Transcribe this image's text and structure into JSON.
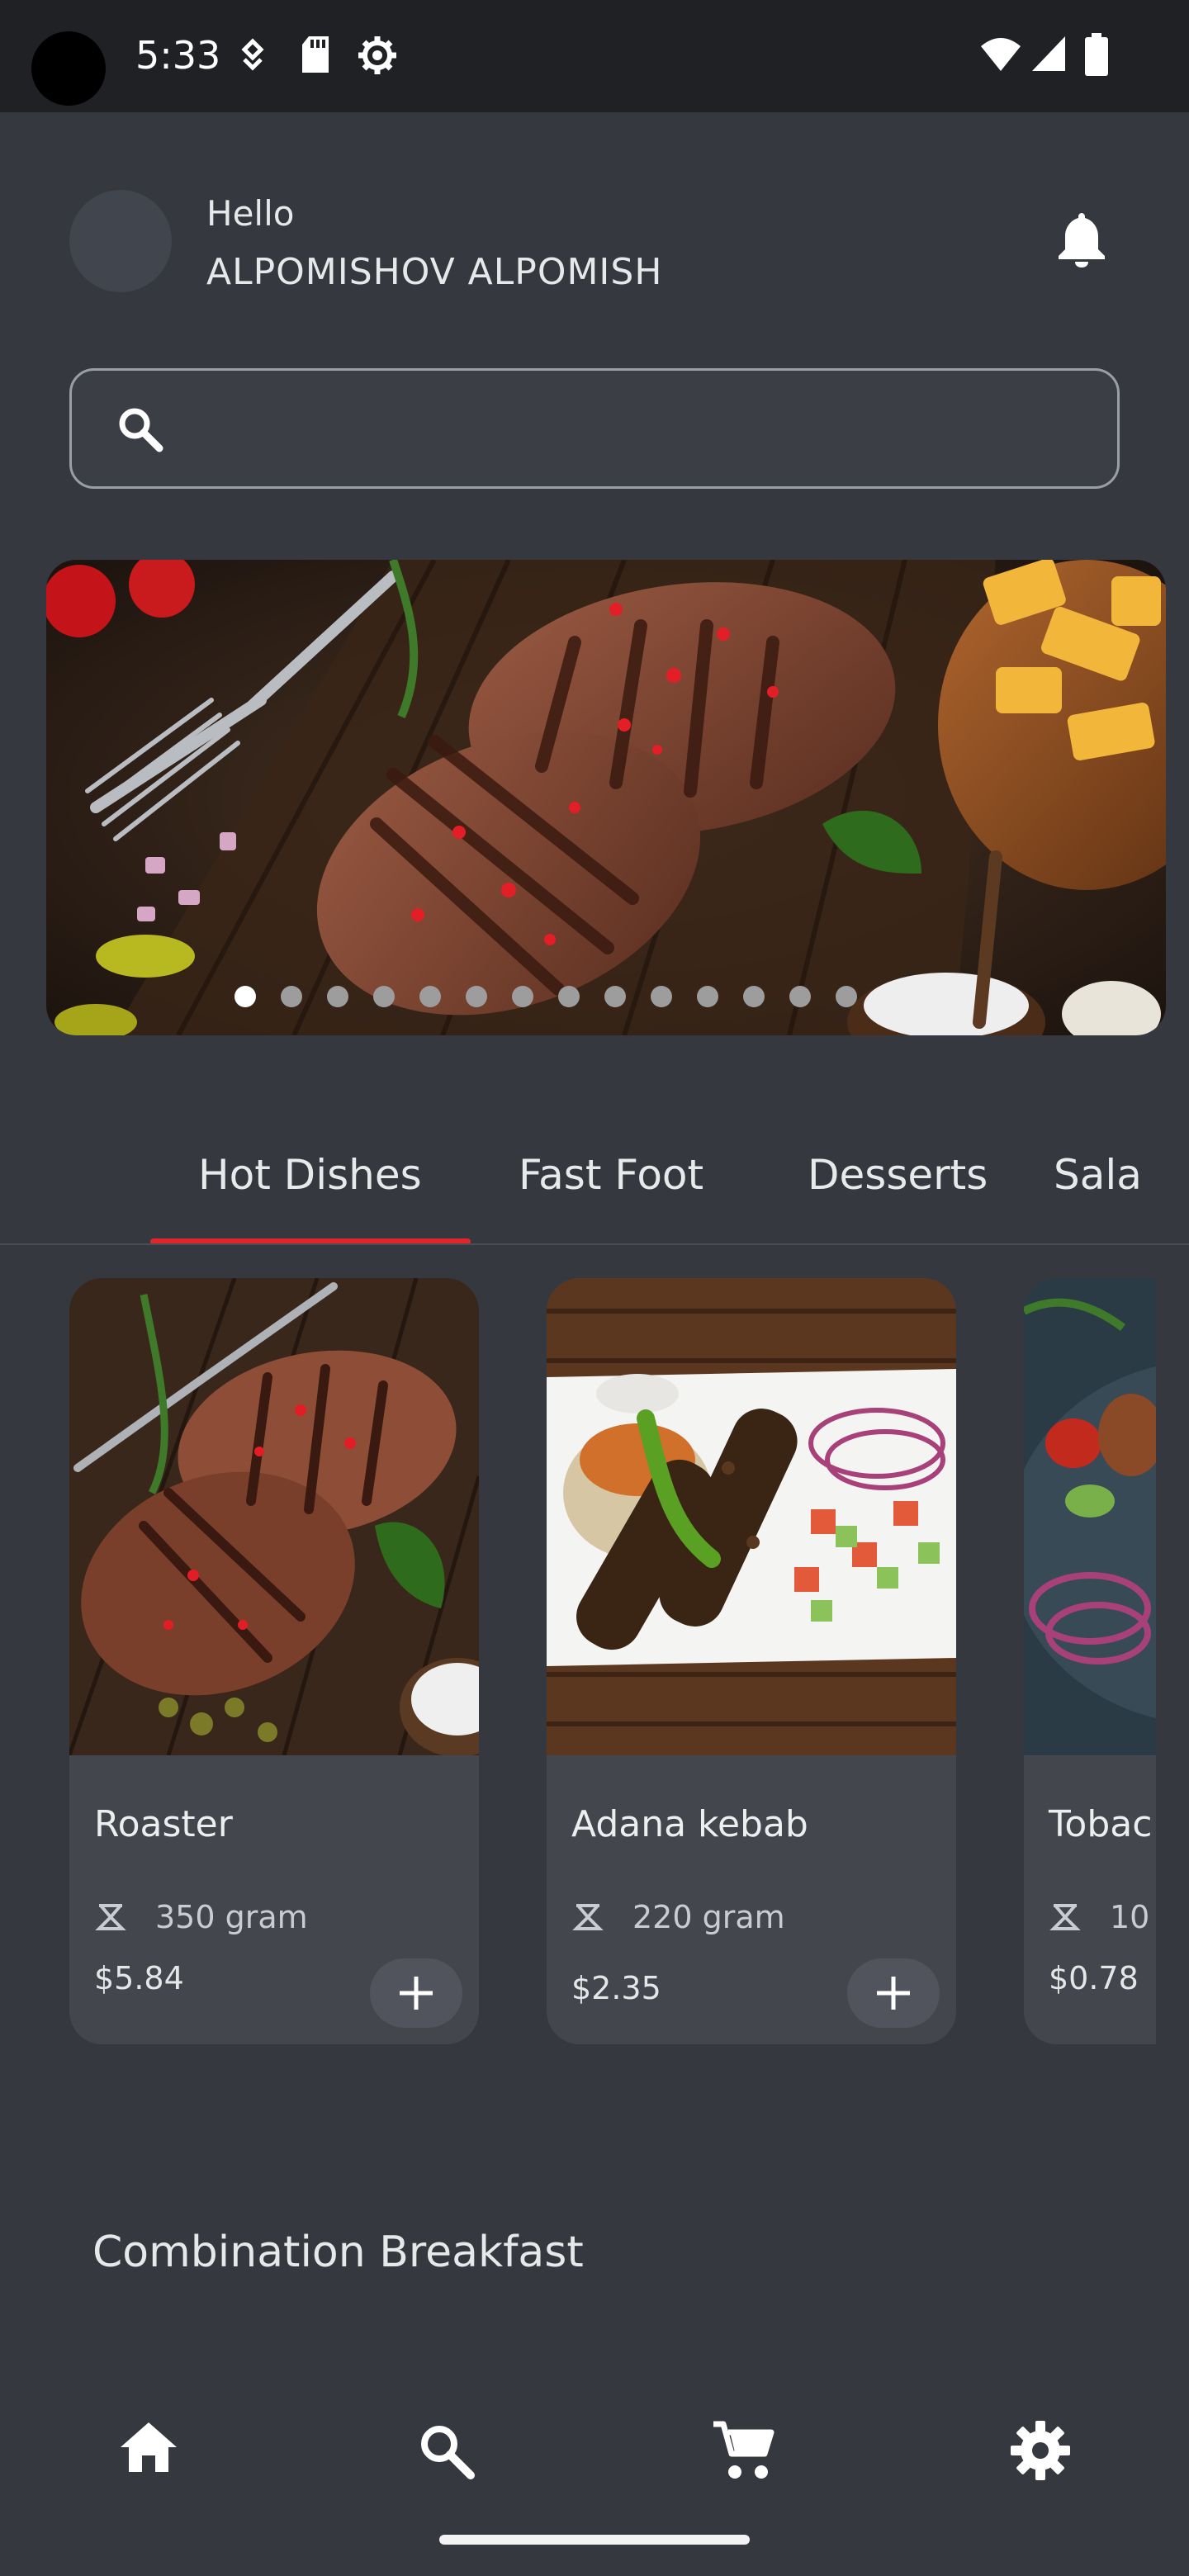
{
  "status_bar": {
    "time": "5:33"
  },
  "header": {
    "greeting": "Hello",
    "username": "ALPOMISHOV ALPOMISH"
  },
  "search": {
    "placeholder": ""
  },
  "carousel": {
    "dot_count": 14,
    "active_index": 0
  },
  "tabs": [
    {
      "label": "Hot Dishes",
      "active": true
    },
    {
      "label": "Fast Foot",
      "active": false
    },
    {
      "label": "Desserts",
      "active": false
    },
    {
      "label": "Sala",
      "active": false
    }
  ],
  "cards": [
    {
      "title": "Roaster",
      "weight": "350 gram",
      "price": "$5.84"
    },
    {
      "title": "Adana kebab",
      "weight": "220 gram",
      "price": "$2.35"
    },
    {
      "title": "Tobac",
      "weight": "10",
      "price": "$0.78"
    }
  ],
  "section": {
    "title": "Combination Breakfast"
  },
  "bottom_nav": [
    "home-icon",
    "search-icon",
    "cart-icon",
    "settings-icon"
  ],
  "colors": {
    "accent": "#e0262b",
    "background": "#35383e",
    "card": "#43464d"
  }
}
